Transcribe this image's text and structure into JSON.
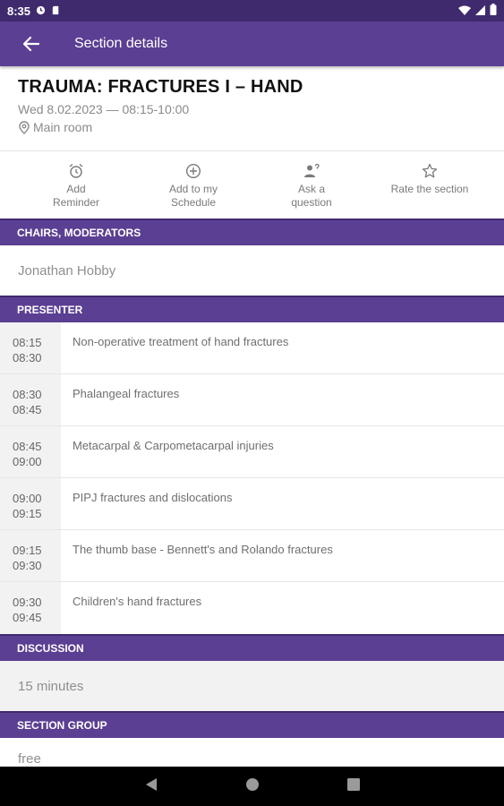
{
  "status_bar": {
    "time": "8:35"
  },
  "app_bar": {
    "title": "Section details"
  },
  "section": {
    "title": "TRAUMA: FRACTURES I – HAND",
    "datetime": "Wed 8.02.2023 — 08:15-10:00",
    "room": "Main room"
  },
  "actions": [
    {
      "label_line1": "Add",
      "label_line2": "Reminder",
      "icon": "alarm-icon"
    },
    {
      "label_line1": "Add to my Schedule",
      "label_line2": "",
      "icon": "add-circle-icon"
    },
    {
      "label_line1": "Ask a",
      "label_line2": "question",
      "icon": "person-question-icon"
    },
    {
      "label_line1": "Rate the section",
      "label_line2": "",
      "icon": "star-icon"
    }
  ],
  "chairs": {
    "header": "CHAIRS, MODERATORS",
    "name": "Jonathan Hobby"
  },
  "presenter": {
    "header": "PRESENTER",
    "talks": [
      {
        "start": "08:15",
        "end": "08:30",
        "title": "Non-operative treatment of hand fractures"
      },
      {
        "start": "08:30",
        "end": "08:45",
        "title": "Phalangeal fractures"
      },
      {
        "start": "08:45",
        "end": "09:00",
        "title": "Metacarpal & Carpometacarpal injuries"
      },
      {
        "start": "09:00",
        "end": "09:15",
        "title": "PIPJ fractures and dislocations"
      },
      {
        "start": "09:15",
        "end": "09:30",
        "title": "The thumb base - Bennett's and Rolando fractures"
      },
      {
        "start": "09:30",
        "end": "09:45",
        "title": "Children's hand fractures"
      }
    ]
  },
  "discussion": {
    "header": "DISCUSSION",
    "value": "15 minutes"
  },
  "section_group": {
    "header": "SECTION GROUP",
    "value": "free"
  },
  "colors": {
    "primary": "#5b3f93",
    "primary_dark": "#3f2a6e"
  }
}
